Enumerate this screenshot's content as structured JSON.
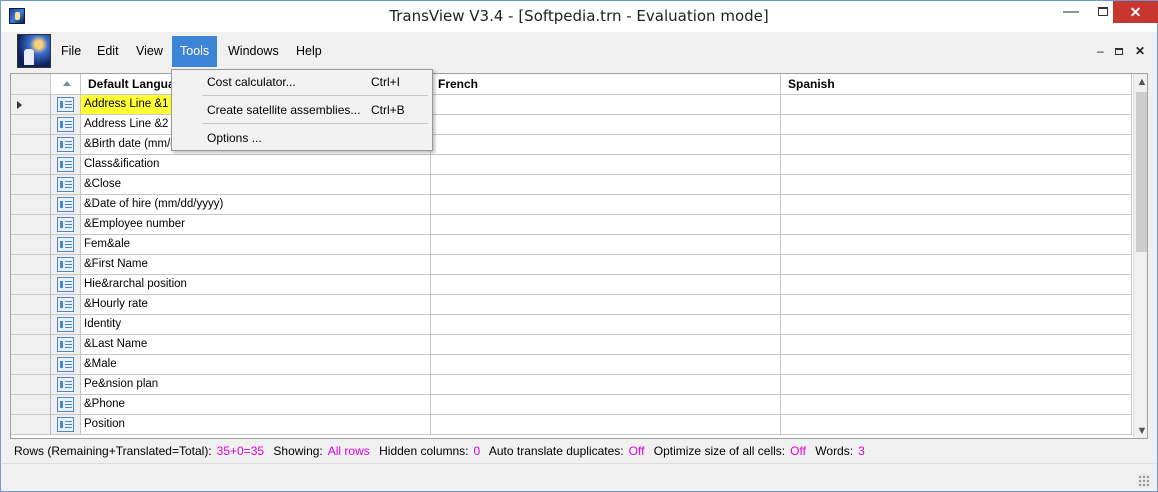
{
  "window": {
    "title": "TransView V3.4 - [Softpedia.trn - Evaluation mode]",
    "controls": {
      "minimize": "—",
      "close": "✕"
    }
  },
  "menu": {
    "items": [
      "File",
      "Edit",
      "View",
      "Tools",
      "Windows",
      "Help"
    ],
    "active": "Tools",
    "mdi_controls": {
      "minimize": "–",
      "close": "✕"
    }
  },
  "tools_menu": {
    "items": [
      {
        "label": "Cost calculator...",
        "shortcut": "Ctrl+I"
      },
      {
        "label": "Create satellite assemblies...",
        "shortcut": "Ctrl+B"
      },
      {
        "label": "Options ...",
        "shortcut": ""
      }
    ]
  },
  "grid": {
    "columns": [
      "Default Langua",
      "French",
      "Spanish"
    ],
    "rows": [
      "Address Line &1",
      "Address Line &2",
      "&Birth date (mm/dd",
      "Class&ification",
      "&Close",
      "&Date of hire (mm/dd/yyyy)",
      "&Employee number",
      "Fem&ale",
      "&First Name",
      "Hie&rarchal position",
      "&Hourly rate",
      "Identity",
      "&Last Name",
      "&Male",
      "Pe&nsion plan",
      "&Phone",
      "Position"
    ],
    "selected_row": 0
  },
  "statusbar": {
    "rows_label": "Rows (Remaining+Translated=Total):",
    "rows_value": "35+0=35",
    "showing_label": "Showing:",
    "showing_value": "All rows",
    "hidden_label": "Hidden columns:",
    "hidden_value": "0",
    "auto_label": "Auto translate duplicates:",
    "auto_value": "Off",
    "optimize_label": "Optimize size of all cells:",
    "optimize_value": "Off",
    "words_label": "Words:",
    "words_value": "3"
  },
  "colors": {
    "menu_active": "#3c84d6",
    "highlight_cell": "#ffff33",
    "status_value": "#e000e0",
    "close_button": "#c7372f"
  }
}
